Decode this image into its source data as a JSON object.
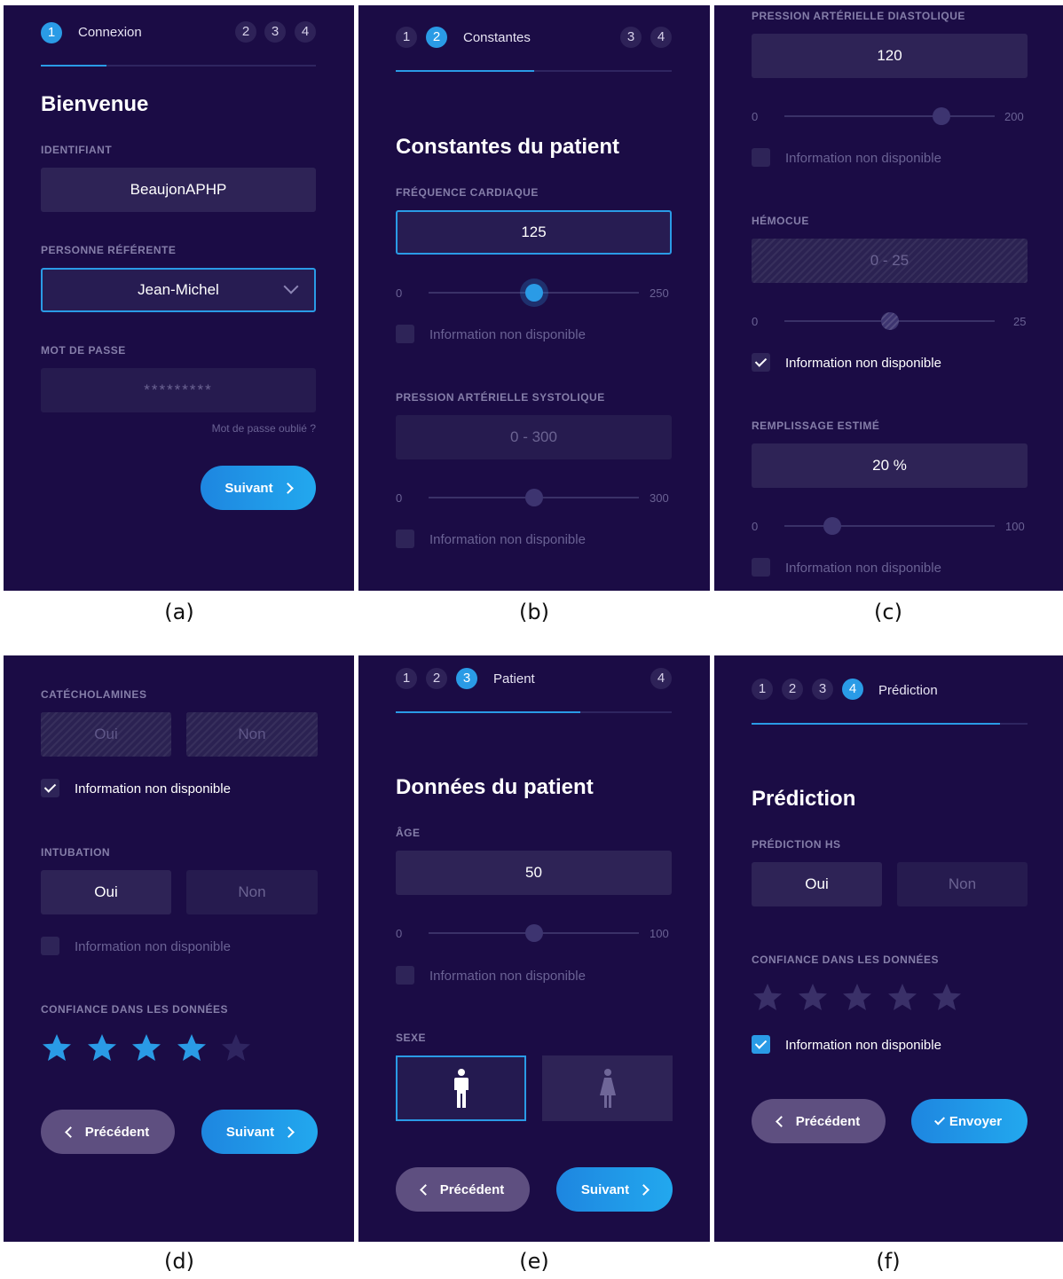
{
  "captions": [
    "(a)",
    "(b)",
    "(c)",
    "(d)",
    "(e)",
    "(f)"
  ],
  "panel_a": {
    "steps": [
      "1",
      "2",
      "3",
      "4"
    ],
    "step_label": "Connexion",
    "title": "Bienvenue",
    "id_label": "IDENTIFIANT",
    "id_value": "BeaujonAPHP",
    "ref_label": "PERSONNE RÉFÉRENTE",
    "ref_value": "Jean-Michel",
    "pwd_label": "MOT DE PASSE",
    "pwd_placeholder": "*********",
    "forgot": "Mot de passe oublié ?",
    "next": "Suivant"
  },
  "panel_b": {
    "steps": [
      "1",
      "2",
      "3",
      "4"
    ],
    "step_label": "Constantes",
    "title": "Constantes du patient",
    "fc_label": "FRÉQUENCE CARDIAQUE",
    "fc_value": "125",
    "fc_min": "0",
    "fc_max": "250",
    "na": "Information non disponible",
    "pas_label": "PRESSION ARTÉRIELLE SYSTOLIQUE",
    "pas_placeholder": "0 - 300",
    "pas_min": "0",
    "pas_max": "300"
  },
  "panel_c": {
    "pad_label": "PRESSION ARTÉRIELLE DIASTOLIQUE",
    "pad_value": "120",
    "pad_min": "0",
    "pad_max": "200",
    "na": "Information non disponible",
    "hemo_label": "HÉMOCUE",
    "hemo_placeholder": "0 - 25",
    "hemo_min": "0",
    "hemo_max": "25",
    "fill_label": "REMPLISSAGE ESTIMÉ",
    "fill_value": "20 %",
    "fill_min": "0",
    "fill_max": "100"
  },
  "panel_d": {
    "cat_label": "CATÉCHOLAMINES",
    "yes": "Oui",
    "no": "Non",
    "na": "Information non disponible",
    "intub_label": "INTUBATION",
    "conf_label": "CONFIANCE DANS LES DONNÉES",
    "rating": 4,
    "rating_max": 5,
    "prev": "Précédent",
    "next": "Suivant"
  },
  "panel_e": {
    "steps": [
      "1",
      "2",
      "3",
      "4"
    ],
    "step_label": "Patient",
    "title": "Données du patient",
    "age_label": "ÂGE",
    "age_value": "50",
    "age_min": "0",
    "age_max": "100",
    "na": "Information non disponible",
    "sex_label": "SEXE",
    "prev": "Précédent",
    "next": "Suivant"
  },
  "panel_f": {
    "steps": [
      "1",
      "2",
      "3",
      "4"
    ],
    "step_label": "Prédiction",
    "title": "Prédiction",
    "pred_label": "PRÉDICTION HS",
    "yes": "Oui",
    "no": "Non",
    "conf_label": "CONFIANCE DANS LES DONNÉES",
    "na": "Information non disponible",
    "prev": "Précédent",
    "send": "Envoyer"
  },
  "colors": {
    "background": "#1b0c45",
    "accent": "#2a9be6",
    "field": "#2e2356"
  },
  "progress": {
    "a": 0.25,
    "b": 0.5,
    "e": 0.67,
    "f": 0.9
  }
}
